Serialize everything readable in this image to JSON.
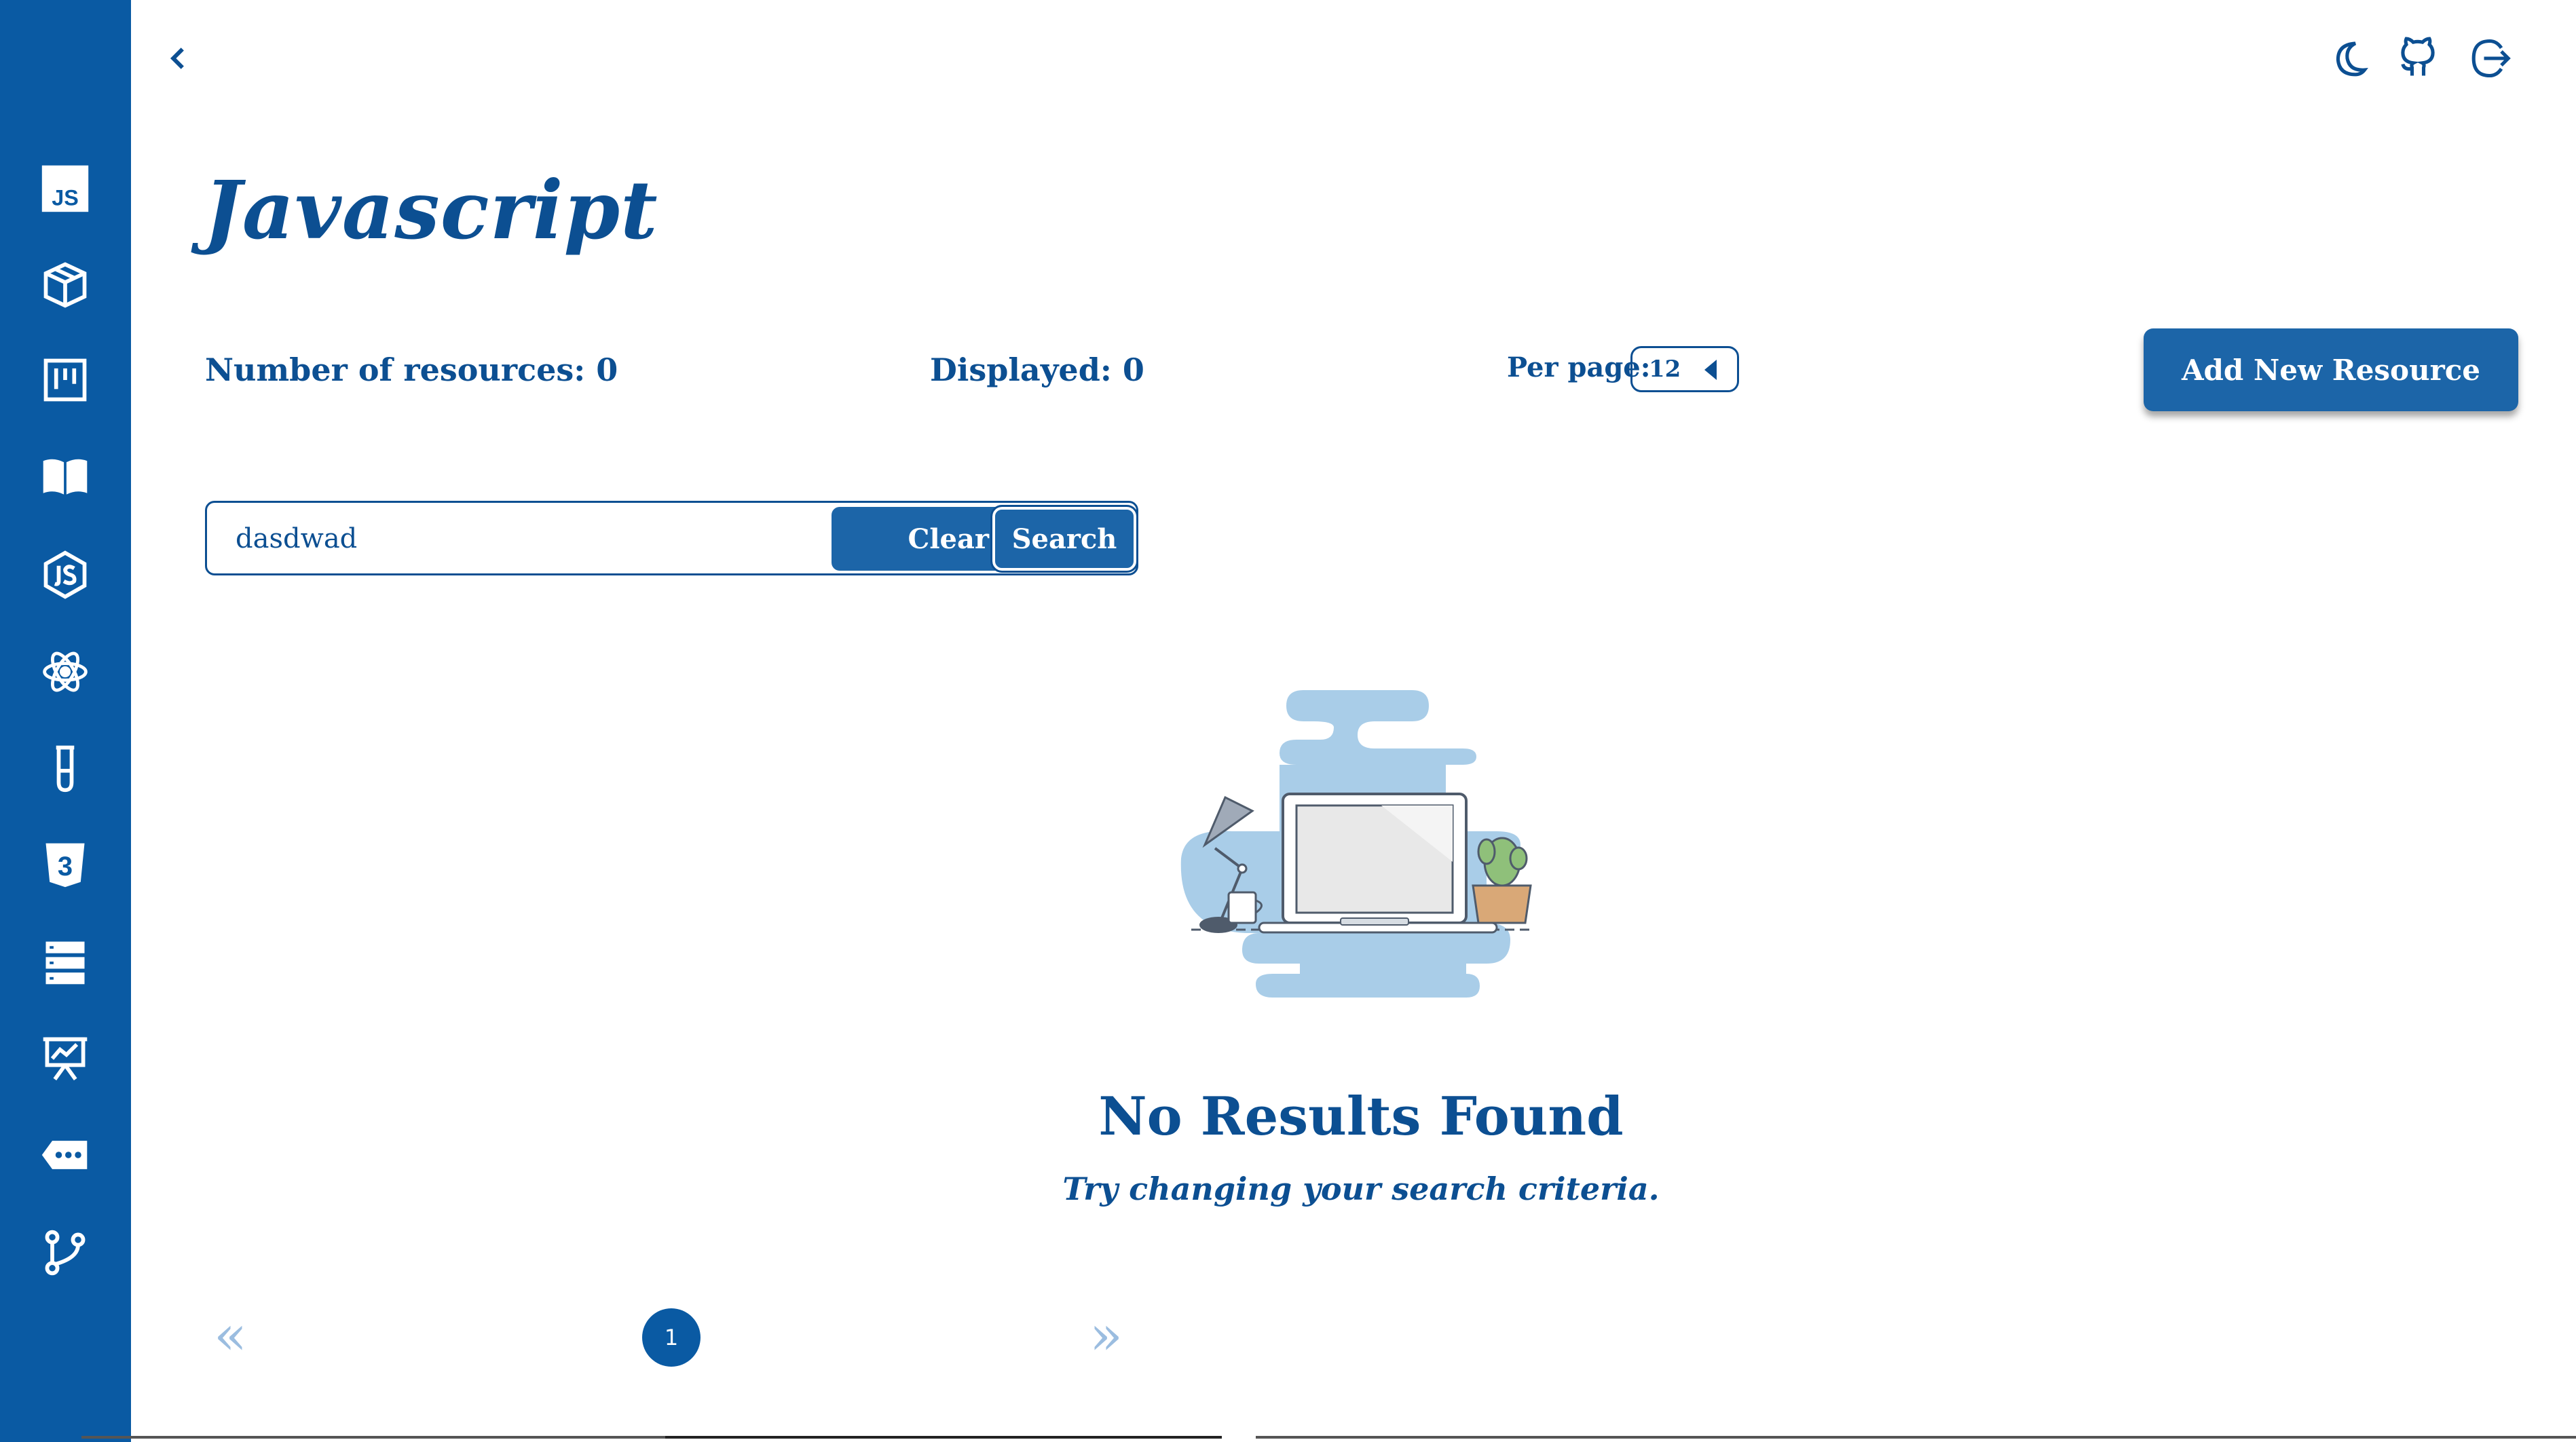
{
  "sidebar": {
    "items": [
      {
        "icon": "js-icon"
      },
      {
        "icon": "box-icon"
      },
      {
        "icon": "kanban-icon"
      },
      {
        "icon": "book-icon"
      },
      {
        "icon": "nodejs-icon"
      },
      {
        "icon": "react-icon"
      },
      {
        "icon": "test-tube-icon"
      },
      {
        "icon": "css3-icon"
      },
      {
        "icon": "server-icon"
      },
      {
        "icon": "presentation-icon"
      },
      {
        "icon": "more-icon"
      },
      {
        "icon": "git-branch-icon"
      }
    ],
    "js_badge": "JS",
    "css_badge": "3"
  },
  "header": {
    "back_icon": "chevron-left-icon",
    "actions": [
      "moon-icon",
      "github-icon",
      "logout-icon"
    ]
  },
  "page": {
    "title": "Javascript",
    "resources_count": "Number of resources: 0",
    "displayed": "Displayed: 0",
    "per_page_label": "Per page:",
    "per_page_value": "12",
    "add_button": "Add New Resource"
  },
  "search": {
    "value": "dasdwad",
    "clear_label": "Clear",
    "search_label": "Search"
  },
  "empty": {
    "title": "No Results Found",
    "subtitle": "Try changing your search criteria."
  },
  "pagination": {
    "prev": "«",
    "next": "»",
    "current": "1"
  },
  "colors": {
    "primary": "#0a5aa3",
    "text": "#0c4f92",
    "button": "#1c65a8",
    "muted": "#9bbde0"
  }
}
